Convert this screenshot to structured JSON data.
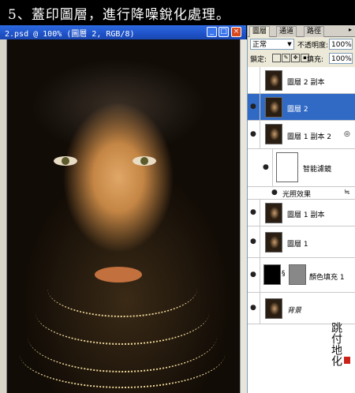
{
  "banner": {
    "text": "5、蓋印圖層，進行降噪銳化處理。"
  },
  "document": {
    "title": "2.psd @ 100% (圖層 2, RGB/8)",
    "controls": {
      "minimize": "_",
      "maximize": "□",
      "close": "×"
    }
  },
  "panel": {
    "tabs": [
      "圖層",
      "通道",
      "路徑"
    ],
    "blend_mode": "正常",
    "opacity_label": "不透明度:",
    "opacity_value": "100%",
    "lock_label": "鎖定:",
    "fill_label": "填充:",
    "fill_value": "100%",
    "layers": [
      {
        "name": "圖層 2 副本",
        "visible": false,
        "selected": false
      },
      {
        "name": "圖層 2",
        "visible": true,
        "selected": true
      },
      {
        "name": "圖層 1 副本 2",
        "visible": true,
        "selected": false
      },
      {
        "name": "智能濾鏡",
        "visible": true,
        "selected": false
      },
      {
        "name": "光照效果",
        "visible": true,
        "selected": false
      },
      {
        "name": "圖層 1 副本",
        "visible": true,
        "selected": false
      },
      {
        "name": "圖層 1",
        "visible": true,
        "selected": false
      },
      {
        "name": "顏色填充 1",
        "visible": true,
        "selected": false
      },
      {
        "name": "背景",
        "visible": true,
        "selected": false
      }
    ]
  },
  "icons": {
    "eye": "eye-icon",
    "lock": "lock-icon",
    "menu": "panel-menu-icon",
    "link": "link-icon"
  },
  "colors": {
    "selection": "#316ac5",
    "titlebar": "#1f52c8"
  }
}
